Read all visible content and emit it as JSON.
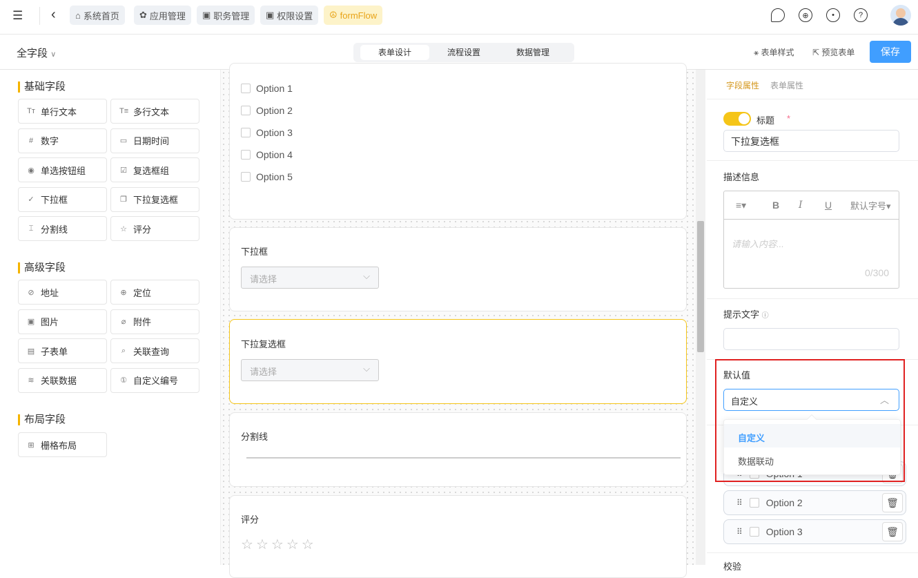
{
  "topbar": {
    "tabs": [
      {
        "label": "系统首页",
        "icon": "home-icon"
      },
      {
        "label": "应用管理",
        "icon": "apps-icon"
      },
      {
        "label": "职务管理",
        "icon": "badge-icon"
      },
      {
        "label": "权限设置",
        "icon": "badge-icon"
      },
      {
        "label": "formFlow",
        "icon": "peace-icon",
        "active": true
      }
    ]
  },
  "toolbar": {
    "scope": "全字段",
    "tabs": [
      "表单设计",
      "流程设置",
      "数据管理"
    ],
    "style_btn": "表单样式",
    "preview_btn": "预览表单",
    "save": "保存"
  },
  "sidebar": {
    "basic_title": "基础字段",
    "basic": [
      {
        "label": "单行文本",
        "icon": "Tт"
      },
      {
        "label": "多行文本",
        "icon": "T≡"
      },
      {
        "label": "数字",
        "icon": "#"
      },
      {
        "label": "日期时间",
        "icon": "▭"
      },
      {
        "label": "单选按钮组",
        "icon": "◉"
      },
      {
        "label": "复选框组",
        "icon": "☑"
      },
      {
        "label": "下拉框",
        "icon": "✓"
      },
      {
        "label": "下拉复选框",
        "icon": "❐"
      },
      {
        "label": "分割线",
        "icon": "⌶"
      },
      {
        "label": "评分",
        "icon": "☆"
      }
    ],
    "advanced_title": "高级字段",
    "advanced": [
      {
        "label": "地址",
        "icon": "⊘"
      },
      {
        "label": "定位",
        "icon": "⊕"
      },
      {
        "label": "图片",
        "icon": "▣"
      },
      {
        "label": "附件",
        "icon": "⌀"
      },
      {
        "label": "子表单",
        "icon": "▤"
      },
      {
        "label": "关联查询",
        "icon": "⌕"
      },
      {
        "label": "关联数据",
        "icon": "≋"
      },
      {
        "label": "自定义编号",
        "icon": "①"
      }
    ],
    "layout_title": "布局字段",
    "layout": [
      {
        "label": "栅格布局",
        "icon": "⊞"
      }
    ]
  },
  "canvas": {
    "checkbox_options": [
      "Option 1",
      "Option 2",
      "Option 3",
      "Option 4",
      "Option 5"
    ],
    "dropdown": {
      "label": "下拉框",
      "placeholder": "请选择"
    },
    "multi_dropdown": {
      "label": "下拉复选框",
      "placeholder": "请选择"
    },
    "divider": {
      "label": "分割线"
    },
    "rating": {
      "label": "评分",
      "stars": 5
    }
  },
  "props": {
    "tabs": [
      "字段属性",
      "表单属性"
    ],
    "title_label": "标题",
    "required_mark": "*",
    "title_value": "下拉复选框",
    "title_toggle": true,
    "desc_label": "描述信息",
    "font_size": "默认字号",
    "desc_placeholder": "请输入内容...",
    "desc_count": "0/300",
    "hint_label": "提示文字",
    "hint_value": "",
    "default_label": "默认值",
    "default_value": "自定义",
    "default_options": [
      "自定义",
      "数据联动"
    ],
    "options": [
      "Option 1",
      "Option 2",
      "Option 3"
    ],
    "validate_label": "校验"
  },
  "colors": {
    "accent": "#f5c518",
    "primary": "#409eff",
    "highlight": "#e02020"
  }
}
